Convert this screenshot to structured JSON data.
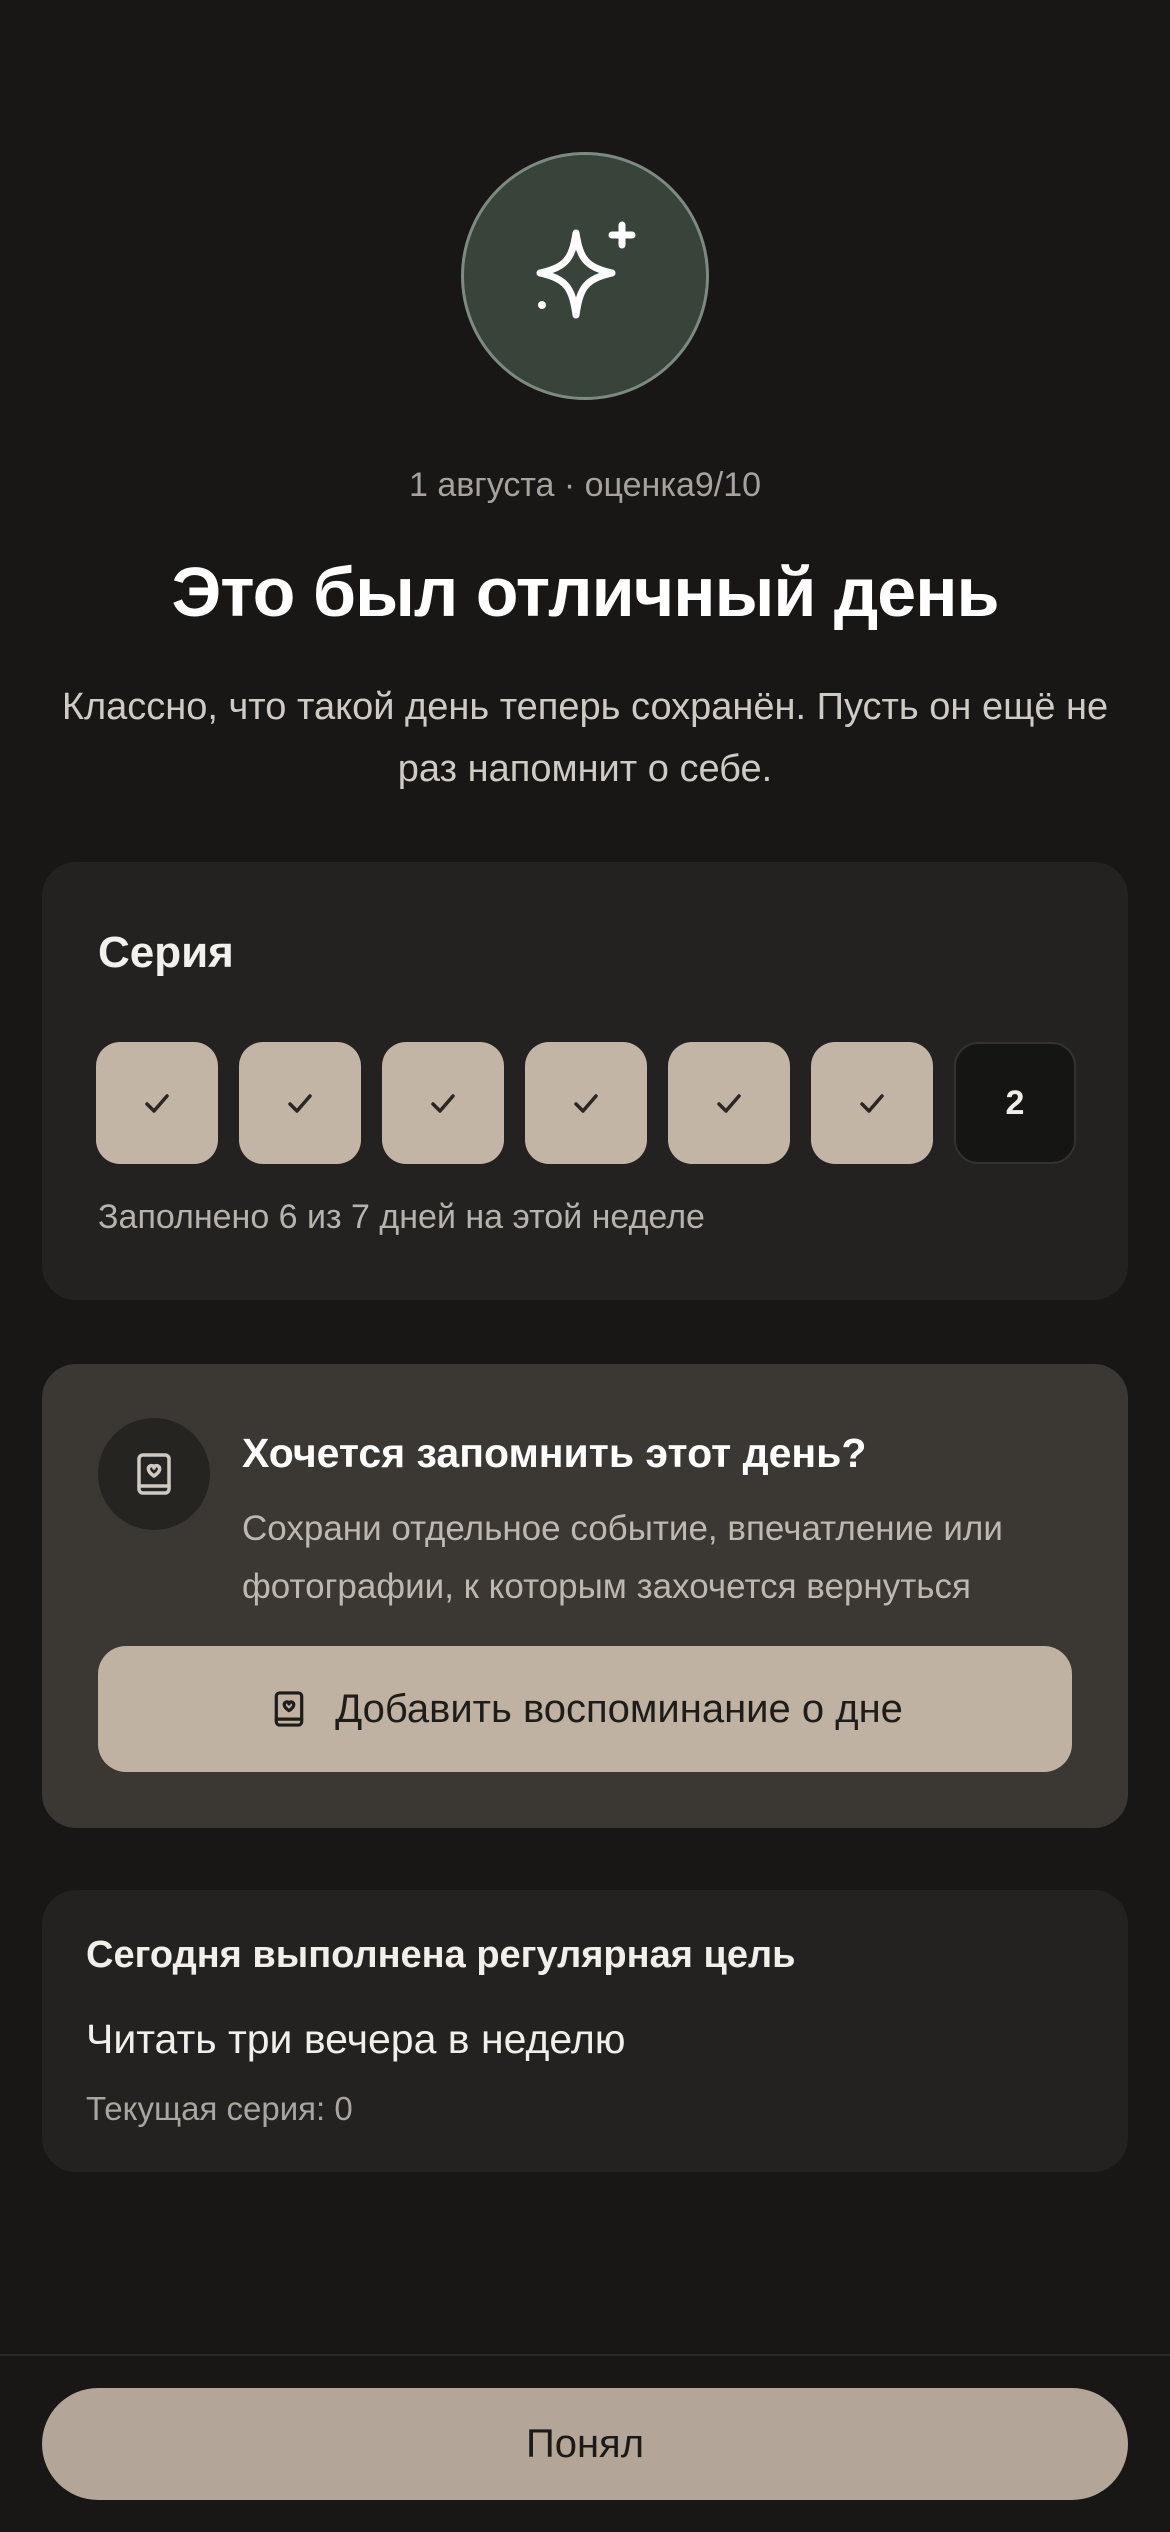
{
  "hero": {
    "icon": "sparkles-icon",
    "meta": "1 августа · оценка9/10",
    "title": "Это был отличный день",
    "subtitle": "Классно, что такой день теперь сохранён. Пусть он ещё не раз напомнит о себе."
  },
  "streak": {
    "title": "Серия",
    "days": [
      {
        "status": "done",
        "icon": "check-icon"
      },
      {
        "status": "done",
        "icon": "check-icon"
      },
      {
        "status": "done",
        "icon": "check-icon"
      },
      {
        "status": "done",
        "icon": "check-icon"
      },
      {
        "status": "done",
        "icon": "check-icon"
      },
      {
        "status": "done",
        "icon": "check-icon"
      },
      {
        "status": "pending",
        "label": "2"
      }
    ],
    "caption": "Заполнено 6 из 7 дней на этой неделе"
  },
  "memory": {
    "icon": "memory-book-icon",
    "title": "Хочется запомнить этот день?",
    "text": "Сохрани отдельное событие, впечатление или фотографии, к которым захочется вернуться",
    "button_label": "Добавить воспоминание о дне"
  },
  "goal": {
    "heading": "Сегодня выполнена регулярная цель",
    "name": "Читать три вечера в неделю",
    "streak": "Текущая серия: 0"
  },
  "footer": {
    "button_label": "Понял"
  },
  "colors": {
    "background": "#181715",
    "accent": "#bfb2a3",
    "hero_circle": "#38433a"
  }
}
